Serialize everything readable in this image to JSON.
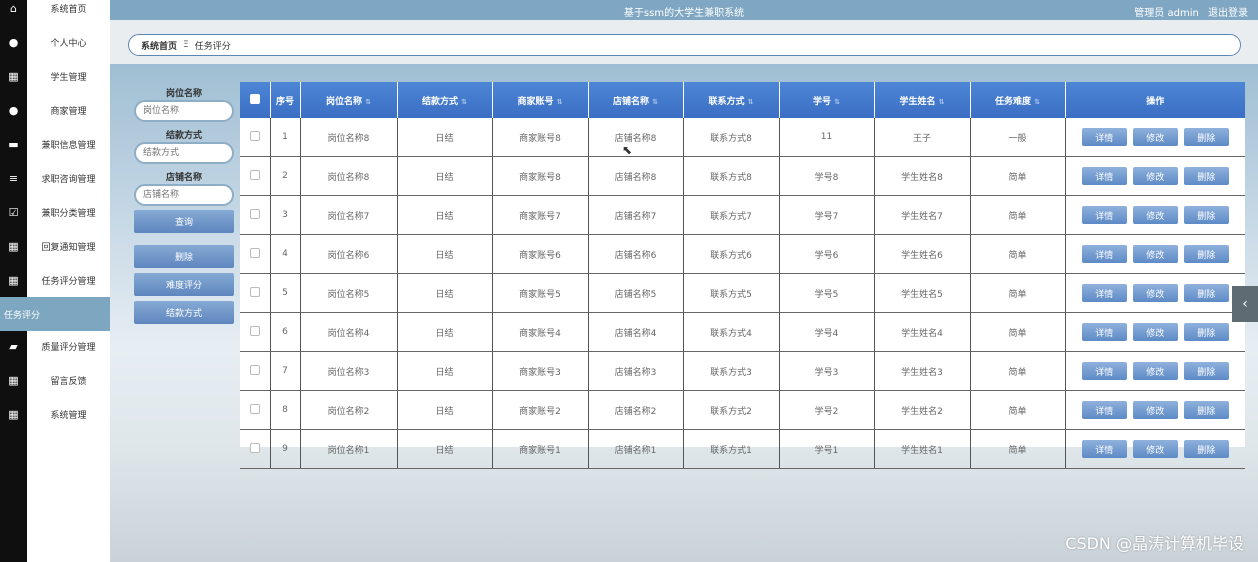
{
  "header": {
    "title": "基于ssm的大学生兼职系统",
    "user_label": "管理员 admin",
    "logout": "退出登录"
  },
  "breadcrumb": {
    "home": "系统首页",
    "separator": "Ξ",
    "current": "任务评分"
  },
  "sidebar": {
    "items": [
      {
        "label": "系统首页",
        "icon": "home-icon"
      },
      {
        "label": "个人中心",
        "icon": "user-icon"
      },
      {
        "label": "学生管理",
        "icon": "grid-icon"
      },
      {
        "label": "商家管理",
        "icon": "user-icon"
      },
      {
        "label": "兼职信息管理",
        "icon": "briefcase-icon"
      },
      {
        "label": "求职咨询管理",
        "icon": "list-icon"
      },
      {
        "label": "兼职分类管理",
        "icon": "check-square-icon"
      },
      {
        "label": "回复通知管理",
        "icon": "grid-icon"
      },
      {
        "label": "任务评分管理",
        "icon": "grid-icon"
      },
      {
        "label": "任务评分",
        "icon": "",
        "active": true
      },
      {
        "label": "质量评分管理",
        "icon": "chat-icon"
      },
      {
        "label": "留言反馈",
        "icon": "grid-icon"
      },
      {
        "label": "系统管理",
        "icon": "grid-icon"
      }
    ]
  },
  "search": {
    "fields": [
      {
        "label": "岗位名称",
        "placeholder": "岗位名称"
      },
      {
        "label": "结款方式",
        "placeholder": "结款方式"
      },
      {
        "label": "店铺名称",
        "placeholder": "店铺名称"
      }
    ],
    "query_button": "查询",
    "actions": [
      "删除",
      "难度评分",
      "结款方式"
    ]
  },
  "table": {
    "columns": [
      "序号",
      "岗位名称",
      "结款方式",
      "商家账号",
      "店铺名称",
      "联系方式",
      "学号",
      "学生姓名",
      "任务难度",
      "操作"
    ],
    "rows": [
      [
        "1",
        "岗位名称8",
        "日结",
        "商家账号8",
        "店铺名称8",
        "联系方式8",
        "11",
        "王子",
        "一般"
      ],
      [
        "2",
        "岗位名称8",
        "日结",
        "商家账号8",
        "店铺名称8",
        "联系方式8",
        "学号8",
        "学生姓名8",
        "简单"
      ],
      [
        "3",
        "岗位名称7",
        "日结",
        "商家账号7",
        "店铺名称7",
        "联系方式7",
        "学号7",
        "学生姓名7",
        "简单"
      ],
      [
        "4",
        "岗位名称6",
        "日结",
        "商家账号6",
        "店铺名称6",
        "联系方式6",
        "学号6",
        "学生姓名6",
        "简单"
      ],
      [
        "5",
        "岗位名称5",
        "日结",
        "商家账号5",
        "店铺名称5",
        "联系方式5",
        "学号5",
        "学生姓名5",
        "简单"
      ],
      [
        "6",
        "岗位名称4",
        "日结",
        "商家账号4",
        "店铺名称4",
        "联系方式4",
        "学号4",
        "学生姓名4",
        "简单"
      ],
      [
        "7",
        "岗位名称3",
        "日结",
        "商家账号3",
        "店铺名称3",
        "联系方式3",
        "学号3",
        "学生姓名3",
        "简单"
      ],
      [
        "8",
        "岗位名称2",
        "日结",
        "商家账号2",
        "店铺名称2",
        "联系方式2",
        "学号2",
        "学生姓名2",
        "简单"
      ],
      [
        "9",
        "岗位名称1",
        "日结",
        "商家账号1",
        "店铺名称1",
        "联系方式1",
        "学号1",
        "学生姓名1",
        "简单"
      ]
    ],
    "row_actions": [
      "详情",
      "修改",
      "删除"
    ]
  },
  "watermark": "CSDN @晶涛计算机毕设",
  "colors": {
    "accent": "#7da7c1",
    "table_header": "#3f75c9",
    "sidebar_dark": "#0f0f0f"
  }
}
